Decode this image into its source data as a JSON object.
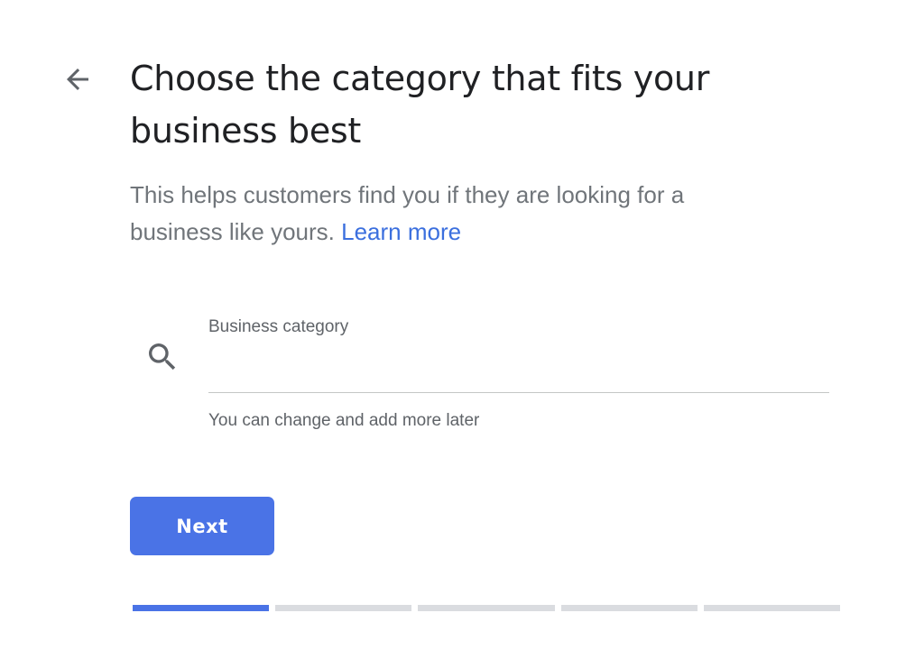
{
  "header": {
    "back_icon": "arrow-back-icon",
    "title": "Choose the category that fits your business best"
  },
  "description": {
    "text": "This helps customers find you if they are looking for a business like yours.",
    "link_label": "Learn more"
  },
  "category_field": {
    "icon": "search-icon",
    "label": "Business category",
    "value": "",
    "helper": "You can change and add more later"
  },
  "actions": {
    "next_label": "Next"
  },
  "progress": {
    "current_step": 1,
    "total_steps": 5
  },
  "colors": {
    "accent": "#4a73e6",
    "link": "#3b6fde",
    "title_text": "#202124",
    "muted_text": "#70757a",
    "inactive_track": "#dadce0"
  }
}
